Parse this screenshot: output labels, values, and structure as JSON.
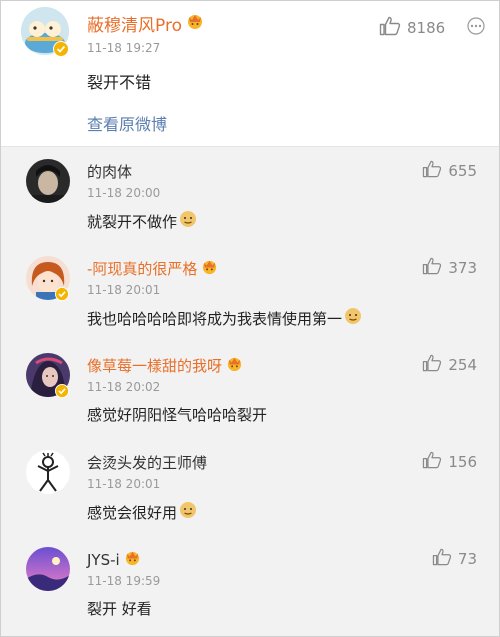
{
  "main_comment": {
    "username": "蔽穆清风Pro",
    "timestamp": "11-18 19:27",
    "text": "裂开不错",
    "likes": "8186",
    "view_original_label": "查看原微博",
    "avatar_icon": "cartoon-avatar-icon",
    "member_badge_icon": "crown-face-icon",
    "verified_badge_color": "#f5b400"
  },
  "replies": [
    {
      "username": "的肉体",
      "timestamp": "11-18 20:00",
      "text": "就裂开不做作",
      "likes": "655",
      "emoji": "doge-emoji",
      "vip": false,
      "verified": false
    },
    {
      "username": "-阿现真的很严格",
      "timestamp": "11-18 20:01",
      "text": "我也哈哈哈哈即将成为我表情使用第一",
      "likes": "373",
      "emoji": "doge-emoji",
      "vip": true,
      "verified": true
    },
    {
      "username": "像草莓一樣甜的我呀",
      "timestamp": "11-18 20:02",
      "text": "感觉好阴阳怪气哈哈哈裂开",
      "likes": "254",
      "emoji": "",
      "vip": true,
      "verified": true
    },
    {
      "username": "会烫头发的王师傅",
      "timestamp": "11-18 20:01",
      "text": "感觉会很好用",
      "likes": "156",
      "emoji": "doge-emoji",
      "vip": false,
      "verified": false
    },
    {
      "username": "JYS-i",
      "timestamp": "11-18 19:59",
      "text": "裂开 好看",
      "likes": "73",
      "emoji": "",
      "vip": true,
      "verified": false
    }
  ],
  "colors": {
    "vip_name": "#e8702a",
    "link": "#5b7fb0",
    "reply_background": "#f2f2f2",
    "muted": "#9a9a9a"
  }
}
